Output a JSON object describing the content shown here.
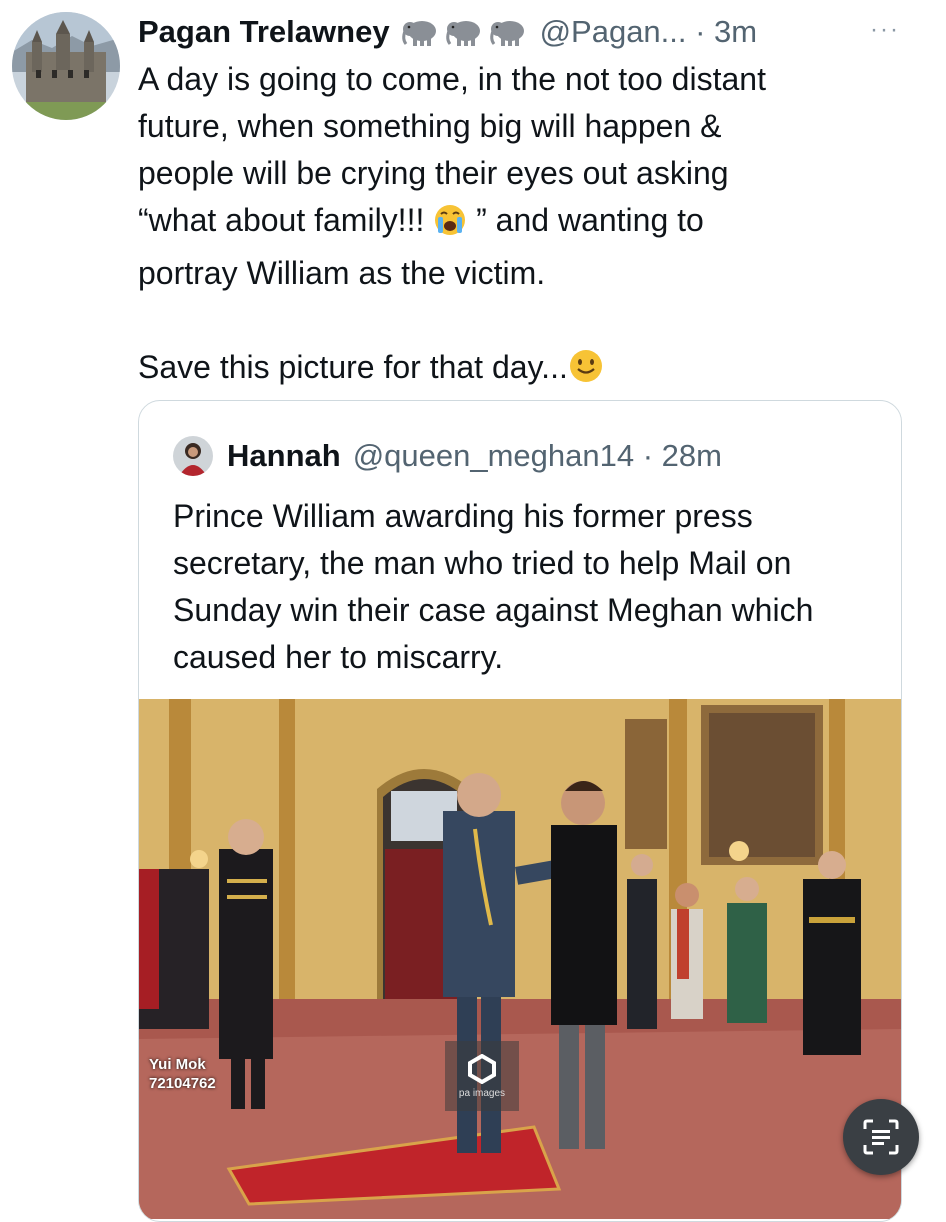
{
  "tweet": {
    "author_name": "Pagan Trelawney",
    "handle_time": "@Pagan... · 3m",
    "badge_icons": [
      "elephant-emoji",
      "elephant-emoji",
      "elephant-emoji"
    ],
    "body_part1": "A day is going to come, in the not too distant\nfuture, when something big will happen &\npeople will be crying their eyes out asking\n“what about family!!! ",
    "body_part2": " ” and wanting to\nportray William as the victim.\n\nSave this picture for that day...",
    "more_label": "···"
  },
  "quoted": {
    "author_name": "Hannah",
    "handle_time": "@queen_meghan14 · 28m",
    "text": "Prince William awarding his former press secretary, the man who tried to help Mail on Sunday win their case against Meghan which caused her to miscarry.",
    "photo_credit_name": "Yui Mok",
    "photo_credit_id": "72104762",
    "watermark": "pa images"
  },
  "colors": {
    "text": "#0f1419",
    "muted": "#536471",
    "border": "#cfd9de",
    "carpet": "#c0242a"
  }
}
